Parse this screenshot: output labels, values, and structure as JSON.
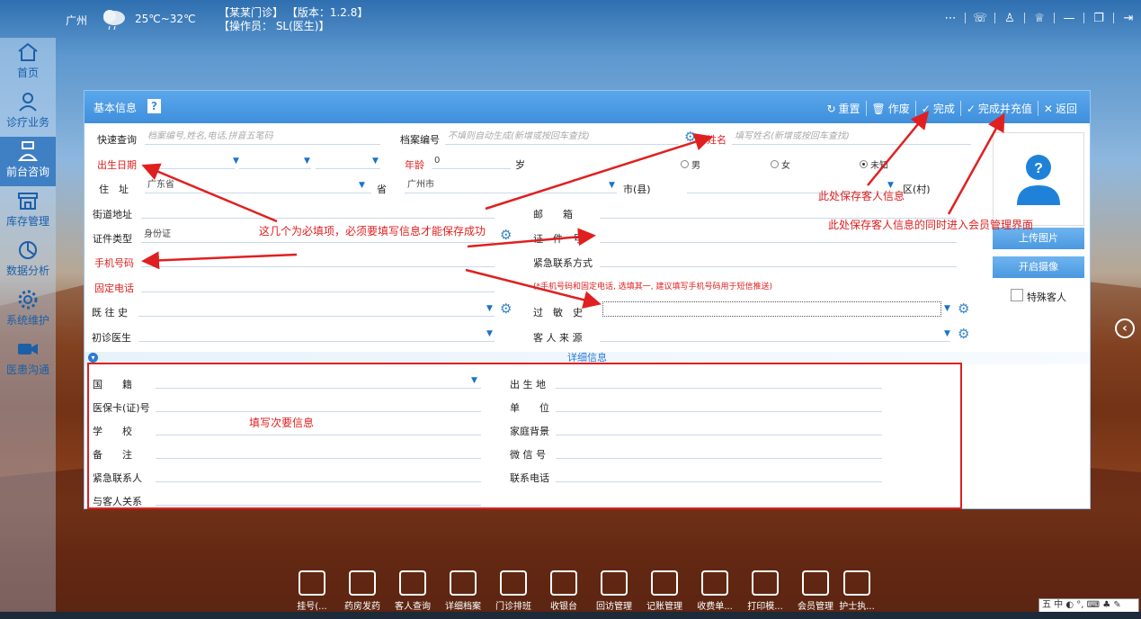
{
  "topbar": {
    "city": "广州",
    "temperature": "25℃~32℃",
    "clinic_line": "【某某门诊】  【版本：1.2.8】",
    "operator_line": "【操作员： SL(医生)】"
  },
  "sidebar": {
    "items": [
      {
        "label": "首页",
        "icon": "home-icon"
      },
      {
        "label": "诊疗业务",
        "icon": "doctor-icon"
      },
      {
        "label": "前台咨询",
        "icon": "nurse-icon"
      },
      {
        "label": "库存管理",
        "icon": "store-icon"
      },
      {
        "label": "数据分析",
        "icon": "chart-icon"
      },
      {
        "label": "系统维护",
        "icon": "gear-icon"
      },
      {
        "label": "医患沟通",
        "icon": "video-icon"
      }
    ]
  },
  "panel": {
    "title": "基本信息",
    "help": "?",
    "actions": {
      "reset": "重置",
      "void": "作废",
      "done": "完成",
      "done_recharge": "完成并充值",
      "back": "返回"
    }
  },
  "form": {
    "quick_search_label": "快速查询",
    "quick_search_ph": "档案编号,姓名,电话,拼音五笔码",
    "file_no_label": "档案编号",
    "file_no_ph": "不填则自动生成(新增或按回车查找)",
    "name_label": "姓名",
    "name_ph": "填写姓名(新增或按回车查找)",
    "birth_label": "出生日期",
    "age_label": "年龄",
    "age_value": "0",
    "age_unit": "岁",
    "gender": {
      "male": "男",
      "female": "女",
      "unknown": "未知",
      "selected": "未知"
    },
    "address_label": "住　址",
    "province_value": "广东省",
    "province_label": "省",
    "city_value": "广州市",
    "city_label": "市(县)",
    "district_label": "区(村)",
    "street_label": "街道地址",
    "mail_label": "邮　　箱",
    "id_type_label": "证件类型",
    "id_type_value": "身份证",
    "id_no_label": "证　件　号",
    "mobile_label": "手机号码",
    "emergency_label": "紧急联系方式",
    "landline_label": "固定电话",
    "phone_note": "(*手机号码和固定电话, 选填其一, 建议填写手机号码用于短信推送)",
    "history_label": "既 往 史",
    "allergy_label": "过　敏　史",
    "first_doctor_label": "初诊医生",
    "source_label": "客 人 来 源",
    "special_label": "特殊客人"
  },
  "photo": {
    "upload": "上传图片",
    "camera": "开启摄像"
  },
  "detail": {
    "header": "详细信息",
    "nationality": "国　　籍",
    "birthplace": "出 生 地",
    "insurance": "医保卡(证)号",
    "company": "单　　位",
    "school": "学　　校",
    "family": "家庭背景",
    "remark": "备　　注",
    "wechat": "微 信 号",
    "emergency_person": "紧急联系人",
    "contact_phone": "联系电话",
    "relation": "与客人关系"
  },
  "annotations": {
    "required": "这几个为必填项，必须要填写信息才能保存成功",
    "save": "此处保存客人信息",
    "save_member": "此处保存客人信息的同时进入会员管理界面",
    "secondary": "填写次要信息"
  },
  "dock": {
    "items": [
      "挂号(...",
      "药房发药",
      "客人查询",
      "详细档案",
      "门诊排班",
      "收银台",
      "回访管理",
      "记账管理",
      "收费单...",
      "打印模...",
      "会员管理",
      "护士执..."
    ]
  },
  "ime": "五 中 ◐ °, ⌨ ♣ ✎",
  "colors": {
    "accent": "#3f8fdc",
    "required": "#e02020"
  }
}
